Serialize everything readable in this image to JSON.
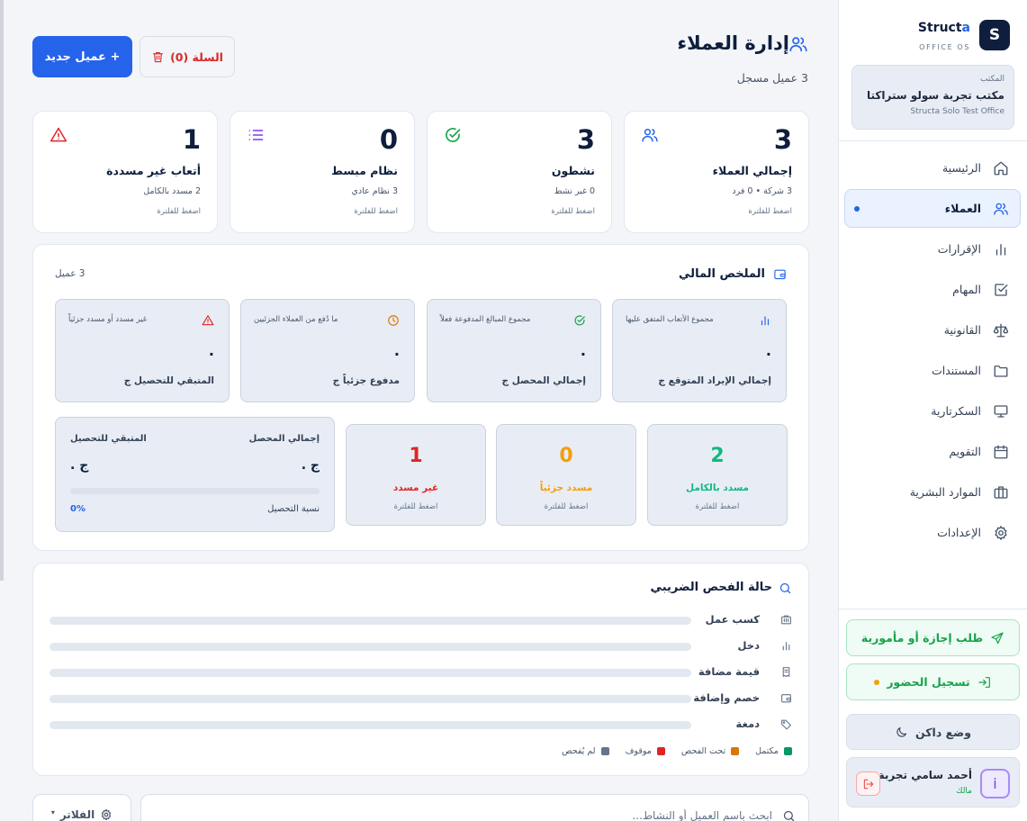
{
  "sidebar": {
    "brand": {
      "logo_letter": "S",
      "name_main": "Struct",
      "name_accent": "a",
      "subtitle": "OFFICE OS"
    },
    "office": {
      "label": "المكتب",
      "name": "مكتب تجربة سولو ستراكتا",
      "name_en": "Structa Solo Test Office"
    },
    "nav": [
      {
        "label": "الرئيسية",
        "icon": "home-icon"
      },
      {
        "label": "العملاء",
        "icon": "users-icon",
        "active": true
      },
      {
        "label": "الإقرارات",
        "icon": "bar-chart-icon"
      },
      {
        "label": "المهام",
        "icon": "checkbox-icon"
      },
      {
        "label": "القانونية",
        "icon": "scale-icon"
      },
      {
        "label": "المستندات",
        "icon": "folder-icon"
      },
      {
        "label": "السكرتارية",
        "icon": "monitor-icon"
      },
      {
        "label": "التقويم",
        "icon": "calendar-icon"
      },
      {
        "label": "الموارد البشرية",
        "icon": "briefcase-icon"
      },
      {
        "label": "الإعدادات",
        "icon": "gear-icon"
      }
    ],
    "leave_request": "طلب إجازة أو مأمورية",
    "attendance": "تسجيل الحضور",
    "dark_mode": "وضع داكن",
    "user": {
      "avatar": "i",
      "name": "أحمد سامي تجربة",
      "role": "مالك"
    }
  },
  "header": {
    "title": "إدارة العملاء",
    "subtitle": "3 عميل مسجل",
    "new_client": "+ عميل جديد",
    "cart": "السلة (0)"
  },
  "stats": [
    {
      "value": "3",
      "label": "إجمالي العملاء",
      "sub": "3 شركة • 0 فرد",
      "hint": "اضغط للفلترة",
      "icon": "users-icon",
      "color": "#2563eb"
    },
    {
      "value": "3",
      "label": "نشطون",
      "sub": "0 غير نشط",
      "hint": "اضغط للفلترة",
      "icon": "check-circle-icon",
      "color": "#16a34a"
    },
    {
      "value": "0",
      "label": "نظام مبسط",
      "sub": "3 نظام عادي",
      "hint": "اضغط للفلترة",
      "icon": "list-icon",
      "color": "#7c3aed"
    },
    {
      "value": "1",
      "label": "أتعاب غير مسددة",
      "sub": "2 مسدد بالكامل",
      "hint": "اضغط للفلترة",
      "icon": "alert-triangle-icon",
      "color": "#dc2626"
    }
  ],
  "financial": {
    "title": "الملخص المالي",
    "count": "3 عميل",
    "cards": [
      {
        "caption": "مجموع الأتعاب المتفق عليها",
        "value": ".",
        "label": "إجمالي الإيراد المتوقع ج",
        "icon": "bar-chart-icon",
        "color": "#2563eb"
      },
      {
        "caption": "مجموع المبالغ المدفوعة فعلاً",
        "value": ".",
        "label": "إجمالي المحصل ج",
        "icon": "check-circle-icon",
        "color": "#16a34a"
      },
      {
        "caption": "ما دُفع من العملاء الجزئيين",
        "value": ".",
        "label": "مدفوع جزئياً ج",
        "icon": "clock-icon",
        "color": "#d97706"
      },
      {
        "caption": "غير مسدد أو مسدد جزئياً",
        "value": ".",
        "label": "المتبقي للتحصيل ج",
        "icon": "alert-triangle-icon",
        "color": "#dc2626"
      }
    ],
    "payments": [
      {
        "value": "2",
        "label": "مسدد بالكامل",
        "hint": "اضغط للفلترة",
        "color": "#10b981"
      },
      {
        "value": "0",
        "label": "مسدد جزئياً",
        "hint": "اضغط للفلترة",
        "color": "#f59e0b"
      },
      {
        "value": "1",
        "label": "غير مسدد",
        "hint": "اضغط للفلترة",
        "color": "#dc2626"
      }
    ],
    "collection": {
      "collected_label": "إجمالي المحصل",
      "collected_value": "ج .",
      "remaining_label": "المتبقي للتحصيل",
      "remaining_value": "ج .",
      "rate_label": "نسبة التحصيل",
      "rate_value": "0%",
      "rate": 0
    }
  },
  "tax": {
    "title": "حالة الفحص الضريبي",
    "rows": [
      {
        "label": "كسب عمل",
        "icon": "building-icon"
      },
      {
        "label": "دخل",
        "icon": "bar-chart-icon"
      },
      {
        "label": "قيمة مضافة",
        "icon": "receipt-icon"
      },
      {
        "label": "خصم وإضافة",
        "icon": "wallet-icon"
      },
      {
        "label": "دمغة",
        "icon": "tag-icon"
      }
    ],
    "legend": [
      {
        "label": "مكتمل",
        "color": "#059669"
      },
      {
        "label": "تحت الفحص",
        "color": "#d97706"
      },
      {
        "label": "موقوف",
        "color": "#dc2626"
      },
      {
        "label": "لم يُفحص",
        "color": "#64748b"
      }
    ]
  },
  "search": {
    "placeholder": "ابحث باسم العميل أو النشاط..."
  },
  "filters": {
    "label": "الفلاتر"
  }
}
